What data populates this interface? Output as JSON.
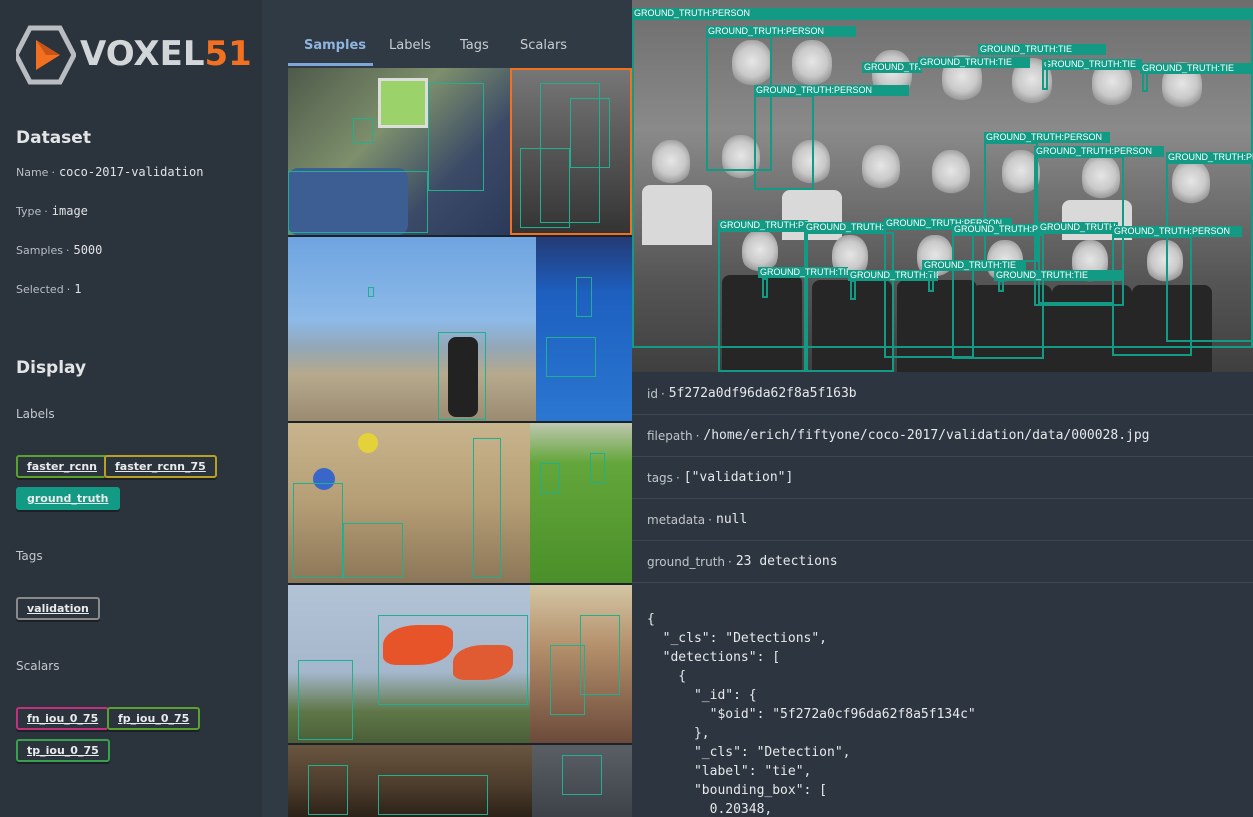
{
  "brand": {
    "name_part1": "VOXEL",
    "name_part2": "51",
    "accent": "#f37021"
  },
  "sidebar": {
    "dataset_title": "Dataset",
    "name_label": "Name",
    "name_value": "coco-2017-validation",
    "type_label": "Type",
    "type_value": "image",
    "samples_label": "Samples",
    "samples_value": "5000",
    "selected_label": "Selected",
    "selected_value": "1",
    "display_title": "Display",
    "labels_heading": "Labels",
    "labels": [
      {
        "label": "faster_rcnn",
        "color": "#5aa12e",
        "active": false
      },
      {
        "label": "faster_rcnn_75",
        "color": "#b8a025",
        "active": false
      },
      {
        "label": "ground_truth",
        "color": "#129a85",
        "active": true
      }
    ],
    "tags_heading": "Tags",
    "tags": [
      {
        "label": "validation",
        "color": "#8a8a8a"
      }
    ],
    "scalars_heading": "Scalars",
    "scalars": [
      {
        "label": "fn_iou_0_75",
        "color": "#c2317c"
      },
      {
        "label": "fp_iou_0_75",
        "color": "#5aa12e"
      },
      {
        "label": "tp_iou_0_75",
        "color": "#37a14d"
      }
    ]
  },
  "tabs": [
    {
      "label": "Samples",
      "active": true
    },
    {
      "label": "Labels",
      "active": false
    },
    {
      "label": "Tags",
      "active": false
    },
    {
      "label": "Scalars",
      "active": false
    }
  ],
  "detail": {
    "detection_label": "GROUND_TRUTH:PERSON",
    "detection_label_tie": "GROUND_TRUTH:TIE",
    "fields": [
      {
        "key": "id",
        "value": "5f272a0df96da62f8a5f163b"
      },
      {
        "key": "filepath",
        "value": "/home/erich/fiftyone/coco-2017/validation/data/000028.jpg"
      },
      {
        "key": "tags",
        "value": "[\"validation\"]"
      },
      {
        "key": "metadata",
        "value": "null"
      },
      {
        "key": "ground_truth",
        "value": "23 detections"
      }
    ],
    "json_text": "{\n  \"_cls\": \"Detections\",\n  \"detections\": [\n    {\n      \"_id\": {\n        \"$oid\": \"5f272a0cf96da62f8a5f134c\"\n      },\n      \"_cls\": \"Detection\",\n      \"label\": \"tie\",\n      \"bounding_box\": [\n        0.20348,"
  }
}
